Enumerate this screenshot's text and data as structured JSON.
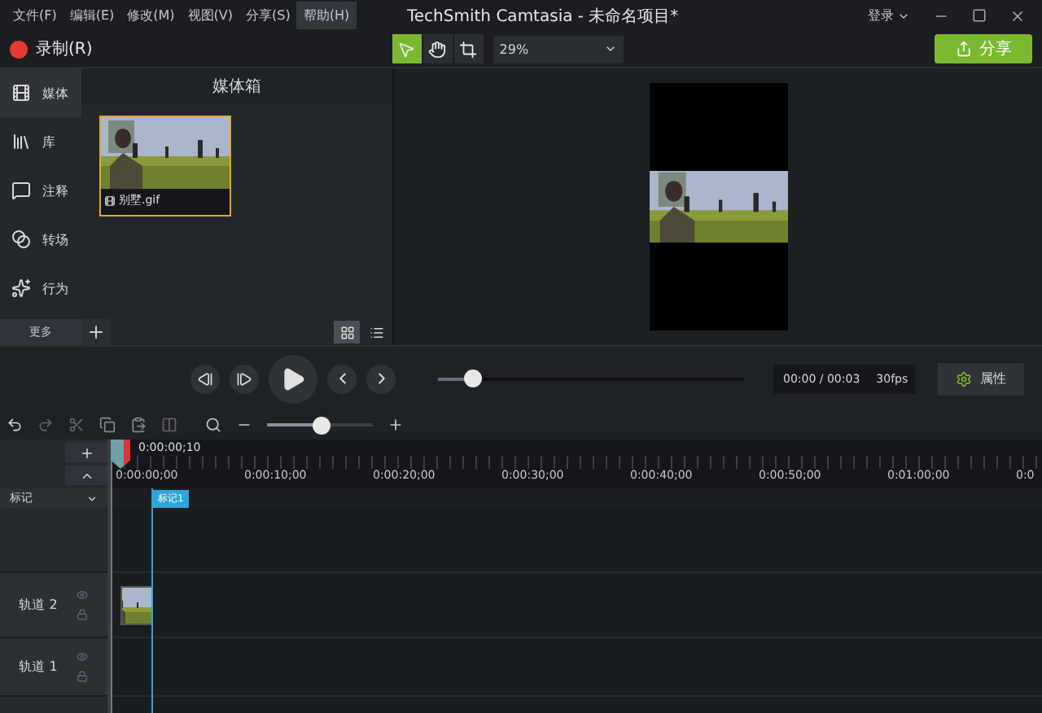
{
  "menu": [
    {
      "label": "文件(F)",
      "selected": false
    },
    {
      "label": "编辑(E)",
      "selected": false
    },
    {
      "label": "修改(M)",
      "selected": false
    },
    {
      "label": "视图(V)",
      "selected": false
    },
    {
      "label": "分享(S)",
      "selected": false
    },
    {
      "label": "帮助(H)",
      "selected": true
    }
  ],
  "window": {
    "title": "TechSmith Camtasia - 未命名项目*",
    "login": "登录"
  },
  "toolbar": {
    "record": "录制(R)",
    "tools": [
      {
        "kind": "select",
        "selected": true
      },
      {
        "kind": "hand",
        "selected": false
      },
      {
        "kind": "crop",
        "selected": false
      }
    ],
    "zoom": "29%",
    "share": "分享"
  },
  "sidebar": {
    "items": [
      {
        "kind": "media",
        "label": "媒体",
        "selected": true
      },
      {
        "kind": "library",
        "label": "库",
        "selected": false
      },
      {
        "kind": "annotation",
        "label": "注释",
        "selected": false
      },
      {
        "kind": "transition",
        "label": "转场",
        "selected": false
      },
      {
        "kind": "behavior",
        "label": "行为",
        "selected": false
      }
    ],
    "more": "更多"
  },
  "media_bin": {
    "title": "媒体箱",
    "items": [
      {
        "name": "别墅.gif",
        "selected": true
      }
    ],
    "views": [
      {
        "kind": "grid",
        "selected": true
      },
      {
        "kind": "list",
        "selected": false
      }
    ]
  },
  "player": {
    "level": 0.11,
    "time": "00:00 / 00:03",
    "fps": "30fps",
    "properties": "属性"
  },
  "timeline": {
    "zoom": {
      "level": 0.5
    },
    "playhead": "0:00:00;10",
    "ruler": [
      "0:00:00;00",
      "0:00:10;00",
      "0:00:20;00",
      "0:00:30;00",
      "0:00:40;00",
      "0:00:50;00",
      "0:01:00;00",
      "0:0"
    ],
    "marker_header": "标记",
    "markers": [
      "标记1"
    ],
    "tracks": [
      {
        "name": "轨道 2",
        "has_clip": true
      },
      {
        "name": "轨道 1",
        "has_clip": false
      }
    ]
  }
}
